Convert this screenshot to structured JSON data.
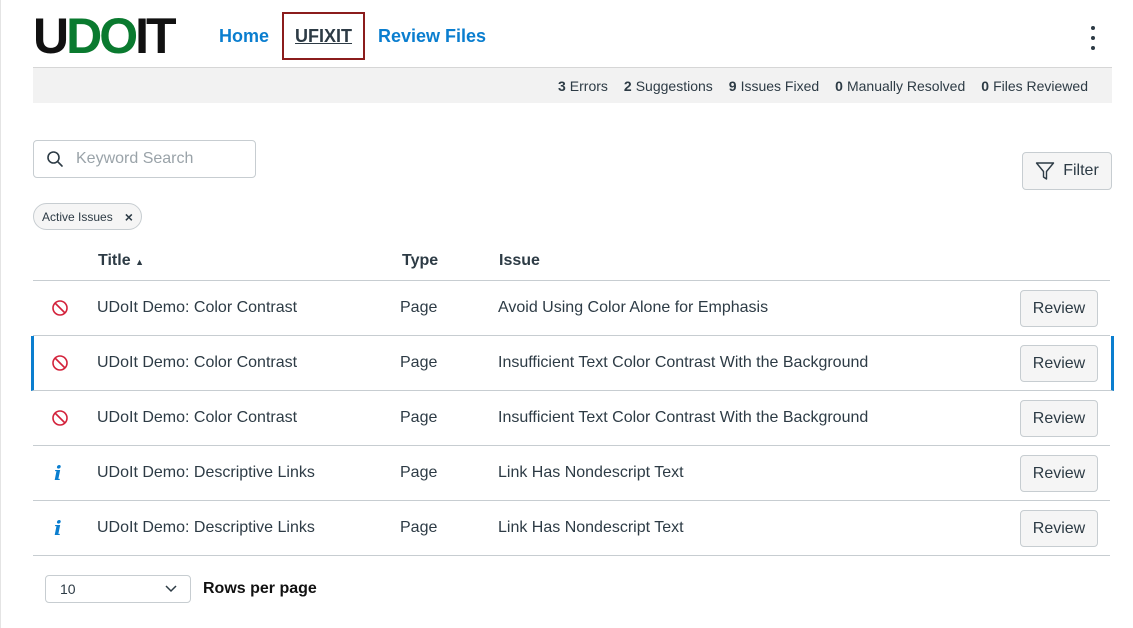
{
  "logo": {
    "part1": "U",
    "part2": "D",
    "part3": "O",
    "part4": "IT"
  },
  "nav": {
    "items": [
      {
        "label": "Home",
        "active": false
      },
      {
        "label": "UFIXIT",
        "active": true
      },
      {
        "label": "Review Files",
        "active": false
      }
    ]
  },
  "stats": [
    {
      "count": "3",
      "label": "Errors"
    },
    {
      "count": "2",
      "label": "Suggestions"
    },
    {
      "count": "9",
      "label": "Issues Fixed"
    },
    {
      "count": "0",
      "label": "Manually Resolved"
    },
    {
      "count": "0",
      "label": "Files Reviewed"
    }
  ],
  "search": {
    "placeholder": "Keyword Search",
    "value": ""
  },
  "filter": {
    "label": "Filter"
  },
  "active_tag": {
    "label": "Active Issues",
    "remove": "×"
  },
  "table": {
    "headers": {
      "title": "Title",
      "sort_indicator": "▲",
      "type": "Type",
      "issue": "Issue"
    },
    "rows": [
      {
        "icon": "error-icon",
        "title": "UDoIt Demo: Color Contrast",
        "type": "Page",
        "issue": "Avoid Using Color Alone for Emphasis",
        "action": "Review"
      },
      {
        "icon": "error-icon",
        "title": "UDoIt Demo: Color Contrast",
        "type": "Page",
        "issue": "Insufficient Text Color Contrast With the Background",
        "action": "Review"
      },
      {
        "icon": "error-icon",
        "title": "UDoIt Demo: Color Contrast",
        "type": "Page",
        "issue": "Insufficient Text Color Contrast With the Background",
        "action": "Review"
      },
      {
        "icon": "info-icon",
        "icon_text": "i",
        "title": "UDoIt Demo: Descriptive Links",
        "type": "Page",
        "issue": "Link Has Nondescript Text",
        "action": "Review"
      },
      {
        "icon": "info-icon",
        "icon_text": "i",
        "title": "UDoIt Demo: Descriptive Links",
        "type": "Page",
        "issue": "Link Has Nondescript Text",
        "action": "Review"
      }
    ]
  },
  "pagination": {
    "rows_per_page_value": "10",
    "rows_per_page_label": "Rows per page"
  },
  "colors": {
    "accent": "#0a7ecf",
    "brand_green": "#0a7a2f",
    "error": "#d3213a",
    "active_nav_border": "#8b1c1c"
  }
}
